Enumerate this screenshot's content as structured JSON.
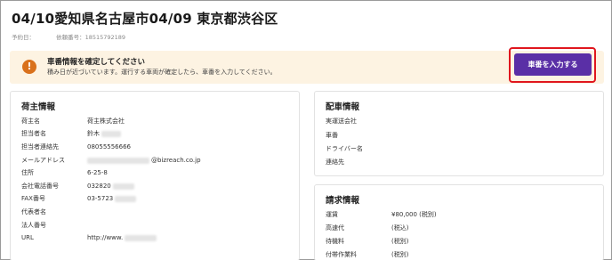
{
  "header": {
    "title": "04/10愛知県名古屋市04/09 東京都渋谷区",
    "reservation_date_label": "予約日：",
    "request_number": "依頼番号：18515792189"
  },
  "alert": {
    "title": "車番情報を確定してください",
    "description": "積み日が近づいています。運行する車両が確定したら、車番を入力してください。",
    "button_label": "車番を入力する",
    "icon": "exclamation-icon",
    "highlight_color": "#e0161e",
    "button_color": "#5a2fa6"
  },
  "shipper": {
    "title": "荷主情報",
    "rows": [
      {
        "label": "荷主名",
        "value": "荷主株式会社"
      },
      {
        "label": "担当者名",
        "value": "鈴木"
      },
      {
        "label": "担当者連絡先",
        "value": "08055556666"
      },
      {
        "label": "メールアドレス",
        "value": "@bizreach.co.jp"
      },
      {
        "label": "住所",
        "value": "6-25-8"
      },
      {
        "label": "会社電話番号",
        "value": "032820"
      },
      {
        "label": "FAX番号",
        "value": "03-5723"
      },
      {
        "label": "代表者名",
        "value": ""
      },
      {
        "label": "法人番号",
        "value": ""
      },
      {
        "label": "URL",
        "value": "http://www."
      }
    ]
  },
  "dispatch": {
    "title": "配車情報",
    "rows": [
      {
        "label": "実運送会社",
        "value": ""
      },
      {
        "label": "車番",
        "value": ""
      },
      {
        "label": "ドライバー名",
        "value": ""
      },
      {
        "label": "連絡先",
        "value": ""
      }
    ]
  },
  "billing": {
    "title": "請求情報",
    "rows": [
      {
        "label": "運賃",
        "value": "¥80,000 (税別)"
      },
      {
        "label": "高速代",
        "value": "(税込)"
      },
      {
        "label": "待機料",
        "value": "(税別)"
      },
      {
        "label": "付帯作業料",
        "value": "(税別)"
      }
    ]
  }
}
